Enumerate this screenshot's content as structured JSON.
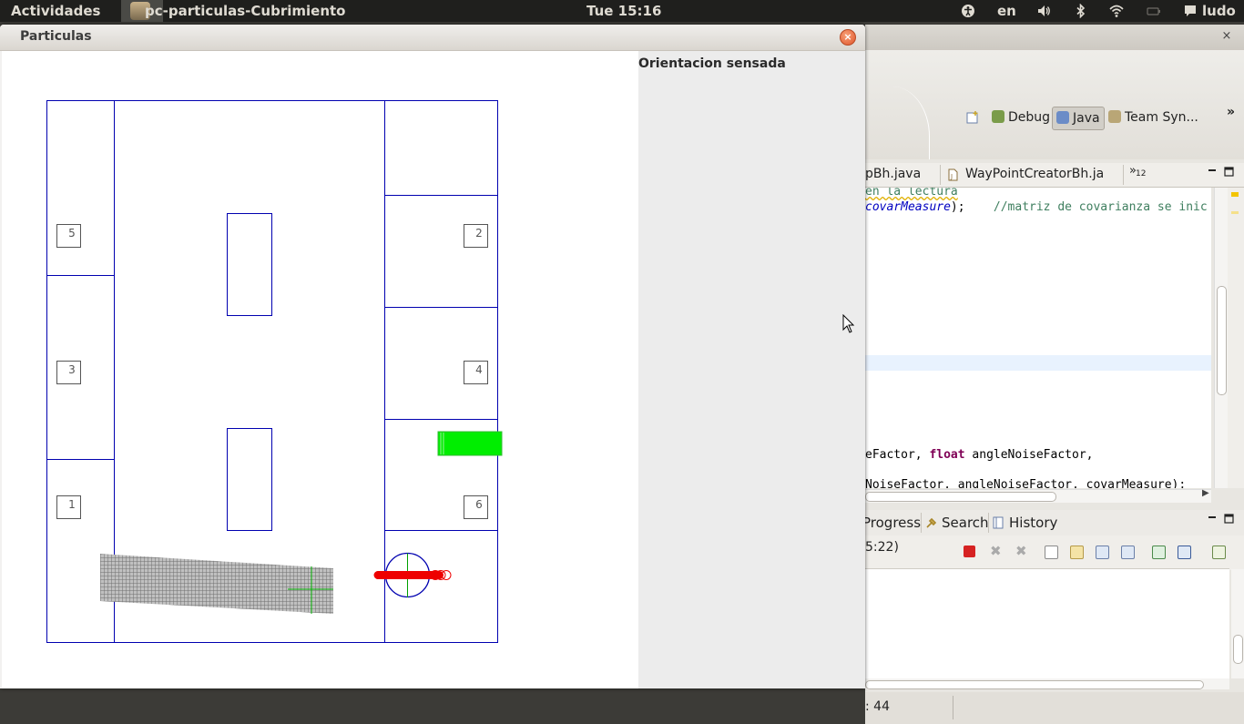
{
  "top_panel": {
    "activities": "Actividades",
    "app_name": "pc-particulas-Cubrimiento",
    "clock": "Tue 15:16",
    "keyboard_layout": "en",
    "user": "ludo"
  },
  "particulas_window": {
    "title": "Particulas",
    "close_symbol": "×",
    "side_panel_label": "Orientacion sensada",
    "map": {
      "room_labels": [
        "5",
        "2",
        "3",
        "4",
        "1",
        "6"
      ],
      "wall_color": "#0000b0",
      "particle_color": "#808080",
      "robot_color": "#ff0000",
      "target_color": "#00ee00"
    }
  },
  "eclipse": {
    "close_symbol": "×",
    "perspectives": {
      "debug": "Debug",
      "java": "Java",
      "team": "Team Syn...",
      "more": "»"
    },
    "editor_tabs": {
      "tab1": "pBh.java",
      "tab2": "WayPointCreatorBh.ja",
      "overflow": "»",
      "overflow_count": "12"
    },
    "code": {
      "line1": "en la lectura",
      "line2_param": "covarMeasure",
      "line2_rest": ");",
      "line2_comment": "//matriz de covarianza se inic",
      "line3_a": "eFactor, ",
      "line3_kw": "float",
      "line3_b": " angleNoiseFactor,",
      "line4": "NoiseFactor, angleNoiseFactor, covarMeasure);"
    },
    "bottom_tabs": {
      "progress": "Progress",
      "search": "Search",
      "history": "History"
    },
    "progress_text": "5:22)",
    "status_position": ": 44"
  }
}
